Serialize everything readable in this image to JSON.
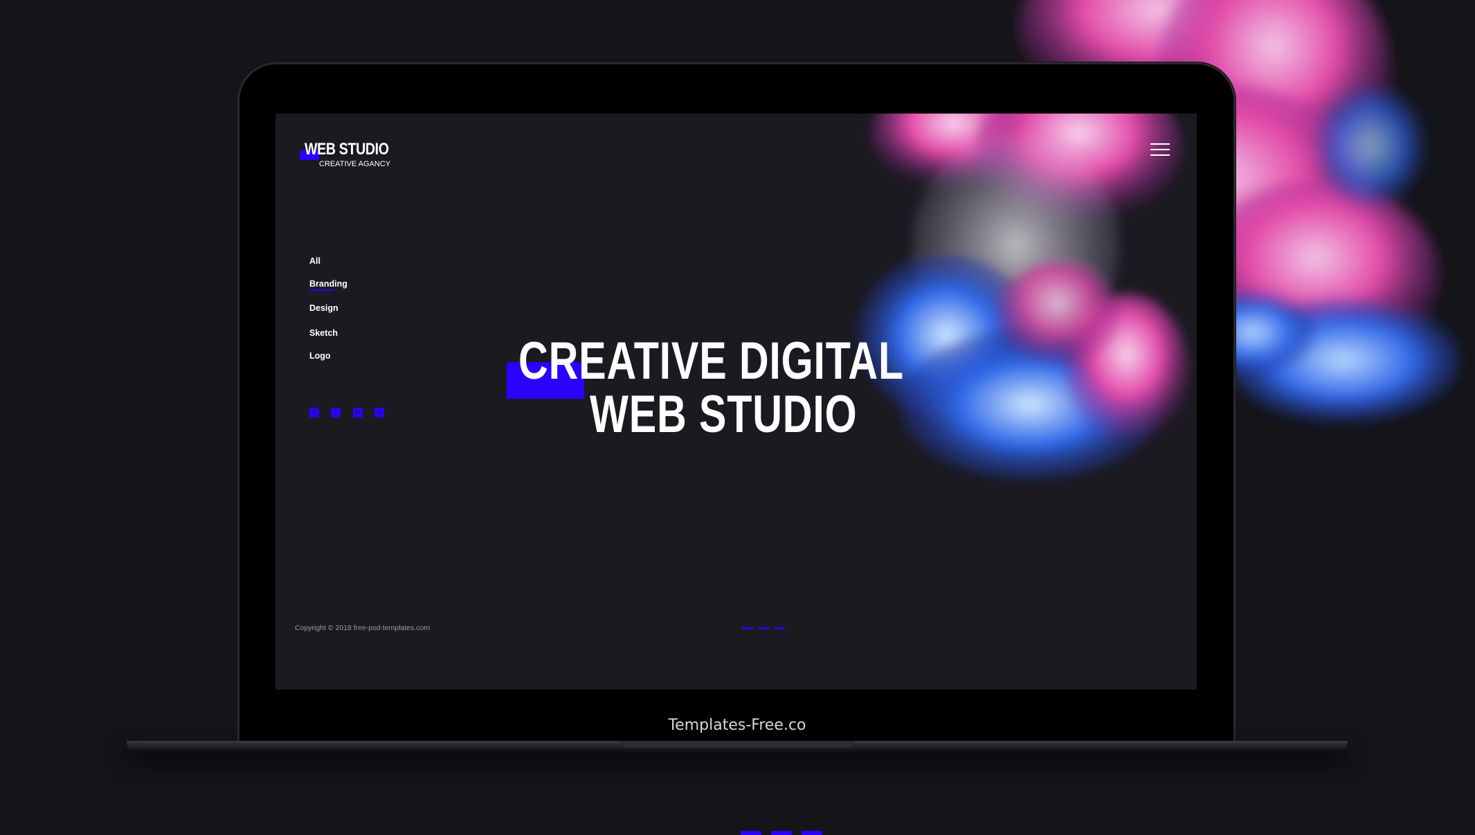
{
  "colors": {
    "background": "#141419",
    "screen": "#1b1a21",
    "accent": "#2a00ff",
    "text": "#ffffff",
    "muted_text": "#9b9ba3",
    "ink_pink": "#e24aa8",
    "ink_blue": "#2f67e8"
  },
  "laptop": {
    "brand_label": "Templates-Free.co"
  },
  "site": {
    "logo": {
      "title": "WEB STUDIO",
      "subtitle": "CREATIVE AGANCY"
    },
    "menu_icon": "hamburger-menu-icon",
    "filters": [
      {
        "label": "All",
        "active": false
      },
      {
        "label": "Branding",
        "active": true
      },
      {
        "label": "Design",
        "active": false
      },
      {
        "label": "Sketch",
        "active": false
      },
      {
        "label": "Logo",
        "active": false
      }
    ],
    "socials": [
      {
        "icon": "facebook-icon",
        "glyph": "f"
      },
      {
        "icon": "twitter-icon",
        "glyph": "t"
      },
      {
        "icon": "google-plus-icon",
        "glyph": "g+"
      },
      {
        "icon": "instagram-icon",
        "glyph": "o"
      }
    ],
    "hero": {
      "line1": "CREATIVE DIGITAL",
      "line2": "WEB STUDIO"
    },
    "copyright": "Copyright © 2018 free-psd-templates.com",
    "slider_dots_count": 3
  }
}
